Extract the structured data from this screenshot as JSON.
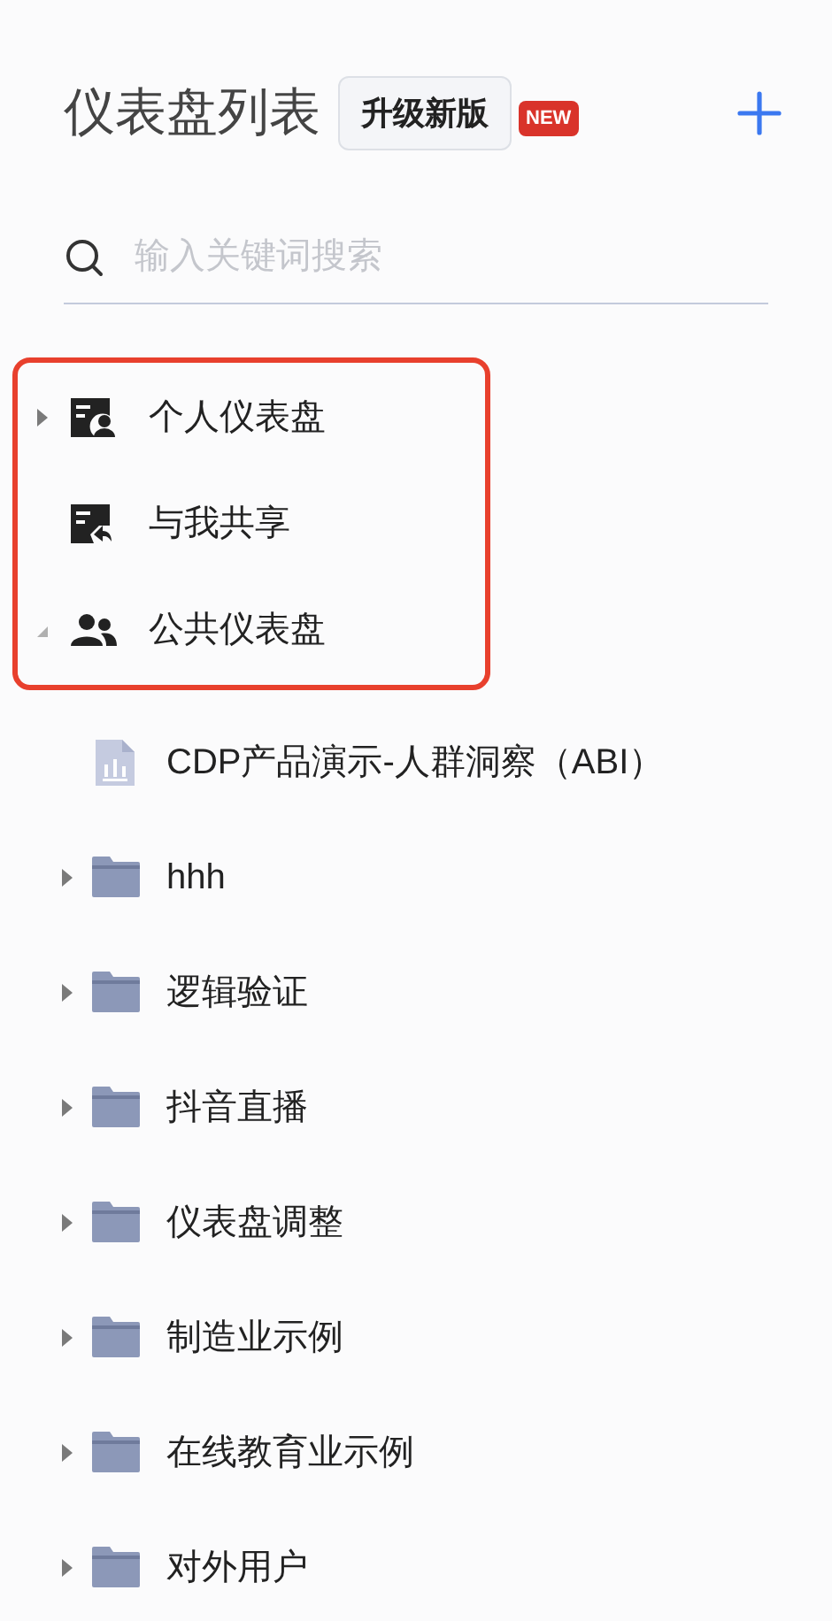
{
  "header": {
    "title": "仪表盘列表",
    "upgrade_button": "升级新版",
    "new_badge": "NEW"
  },
  "search": {
    "placeholder": "输入关键词搜索"
  },
  "sections": [
    {
      "kind": "personal",
      "label": "个人仪表盘",
      "expanded": false
    },
    {
      "kind": "shared",
      "label": "与我共享"
    },
    {
      "kind": "public",
      "label": "公共仪表盘",
      "expanded": true,
      "children": [
        {
          "kind": "dashboard",
          "label": "CDP产品演示-人群洞察（ABI）"
        },
        {
          "kind": "folder",
          "label": "hhh",
          "expanded": false
        },
        {
          "kind": "folder",
          "label": "逻辑验证",
          "expanded": false
        },
        {
          "kind": "folder",
          "label": "抖音直播",
          "expanded": false
        },
        {
          "kind": "folder",
          "label": "仪表盘调整",
          "expanded": false
        },
        {
          "kind": "folder",
          "label": "制造业示例",
          "expanded": false
        },
        {
          "kind": "folder",
          "label": "在线教育业示例",
          "expanded": false
        },
        {
          "kind": "folder",
          "label": "对外用户",
          "expanded": false
        }
      ]
    }
  ]
}
